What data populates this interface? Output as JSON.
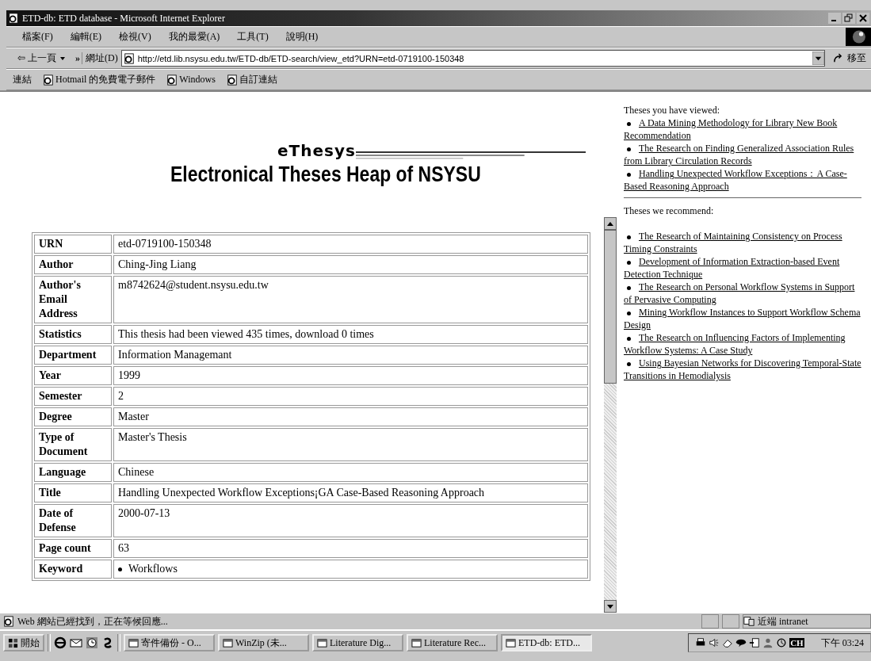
{
  "window": {
    "title": "ETD-db: ETD database - Microsoft Internet Explorer"
  },
  "menu": [
    "檔案(F)",
    "編輯(E)",
    "檢視(V)",
    "我的最愛(A)",
    "工具(T)",
    "說明(H)"
  ],
  "toolbar": {
    "back": "⇦ 上一頁",
    "more": "»"
  },
  "address": {
    "label": "網址(D)",
    "value": "http://etd.lib.nsysu.edu.tw/ETD-db/ETD-search/view_etd?URN=etd-0719100-150348",
    "go": "移至"
  },
  "links": {
    "label": "連結",
    "items": [
      "Hotmail 的免費電子郵件",
      "Windows",
      "自訂連結"
    ]
  },
  "logo": {
    "brand": "eThesys",
    "title": "Electronical Theses Heap of NSYSU"
  },
  "details": [
    {
      "label": "URN",
      "kind": "text",
      "value": "etd-0719100-150348"
    },
    {
      "label": "Author",
      "kind": "text",
      "value": "Ching-Jing Liang"
    },
    {
      "label": "Author's Email Address",
      "kind": "text",
      "value": "m8742624@student.nsysu.edu.tw"
    },
    {
      "label": "Statistics",
      "kind": "text",
      "value": "This thesis had been viewed 435 times, download 0 times"
    },
    {
      "label": "Department",
      "kind": "text",
      "value": "Information Managemant"
    },
    {
      "label": "Year",
      "kind": "text",
      "value": "1999"
    },
    {
      "label": "Semester",
      "kind": "text",
      "value": "2"
    },
    {
      "label": "Degree",
      "kind": "text",
      "value": "Master"
    },
    {
      "label": "Type of Document",
      "kind": "text",
      "value": "Master's Thesis"
    },
    {
      "label": "Language",
      "kind": "text",
      "value": "Chinese"
    },
    {
      "label": "Title",
      "kind": "text",
      "value": "Handling Unexpected Workflow Exceptions¡GA Case-Based Reasoning Approach"
    },
    {
      "label": "Date of Defense",
      "kind": "text",
      "value": "2000-07-13"
    },
    {
      "label": "Page count",
      "kind": "text",
      "value": "63"
    },
    {
      "label": "Keyword",
      "kind": "list",
      "items": [
        "Workflows"
      ]
    }
  ],
  "sidebar": {
    "viewed_heading": "Theses you have viewed:",
    "viewed": [
      "A Data Mining Methodology for Library New Book Recommendation",
      "The Research on Finding Generalized Association Rules from Library Circulation Records",
      "Handling Unexpected Workflow Exceptions：A Case-Based Reasoning Approach"
    ],
    "recommend_heading": "Theses we recommend:",
    "recommend": [
      "The Research of Maintaining Consistency on Process Timing Constraints",
      "Development of Information Extraction-based Event Detection Technique",
      "The Research on Personal Workflow Systems in Support of Pervasive Computing",
      "Mining Workflow Instances to Support Workflow Schema Design",
      "The Research on Influencing Factors of Implementing Workflow Systems: A Case Study",
      "Using Bayesian Networks for Discovering Temporal-State Transitions in Hemodialysis"
    ]
  },
  "status_bar": {
    "text": "Web 網站已經找到，正在等候回應...",
    "zone": "近端 intranet"
  },
  "taskbar": {
    "start": "開始",
    "tasks": [
      {
        "label": "寄件備份 - O...",
        "selected": false
      },
      {
        "label": "WinZip (未...",
        "selected": false
      },
      {
        "label": "Literature Dig...",
        "selected": false
      },
      {
        "label": "Literature Rec...",
        "selected": false
      },
      {
        "label": "ETD-db: ETD...",
        "selected": true
      }
    ],
    "lang": "CH",
    "clock": "下午 03:24"
  }
}
